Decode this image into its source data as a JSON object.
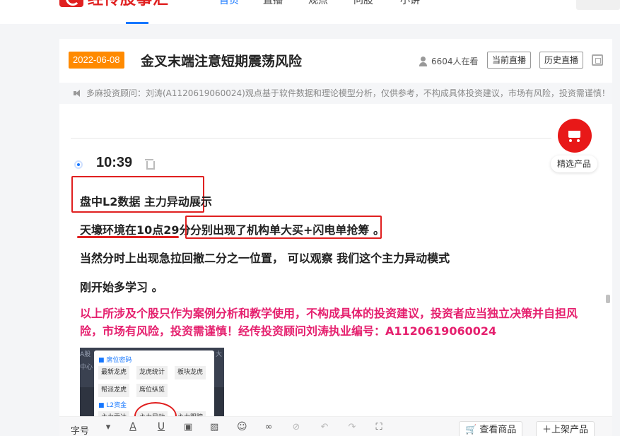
{
  "nav": {
    "logo_text": "经传股事汇",
    "items": [
      "首页",
      "直播",
      "观点",
      "问股",
      "小讲"
    ],
    "active_index": 0,
    "accent": "#1677ff"
  },
  "post": {
    "date": "2022-06-08",
    "title": "金叉末端注意短期震荡风险",
    "viewers": "6604人在看",
    "btn_current": "当前直播",
    "btn_history": "历史直播",
    "disclaimer": "多麻投资顾问：刘涛(A1120619060024)观点基于软件数据和理论模型分析，仅供参考，不构成具体投资建议，市场有风险，投资需谨慎！"
  },
  "entry": {
    "time": "10:39",
    "line1": "盘中L2数据 主力异动展示",
    "line2a": "天壕环境在10点29分",
    "line2b": "分别出现了机构单大买+闪电单抢筹 。",
    "line3": "当然分时上出现急拉回撤二分之一位置， 可以观察 我们这个主力异动模式",
    "line4": "刚开始多学习 。",
    "warning": "以上所涉及个股只作为案例分析和教学使用，不构成具体的投资建议，投资者应当独立决策并自担风险，市场有风险，投资需谨慎！经传投资顾问刘涛执业编号：A1120619060024"
  },
  "screenshot": {
    "strip_left": "A股",
    "strip_mid": "中心",
    "strip_right": "大",
    "section1": "■ 席位密码",
    "chips1": [
      "最新龙虎",
      "龙虎统计",
      "板块龙虎"
    ],
    "chips2": [
      "帮派龙虎",
      "席位纵览"
    ],
    "section2": "■ L2资金",
    "chips3": [
      "主力雷达",
      "主力异动",
      "主力跟踪"
    ]
  },
  "cart": {
    "label": "精选产品",
    "color": "#e81818"
  },
  "toolbar": {
    "font_size_label": "字号",
    "view_products": "查看商品",
    "add_product": "上架产品"
  },
  "colors": {
    "date_badge": "#ff8a00",
    "highlight_red": "#e02020",
    "warning_pink": "#e5206e"
  }
}
